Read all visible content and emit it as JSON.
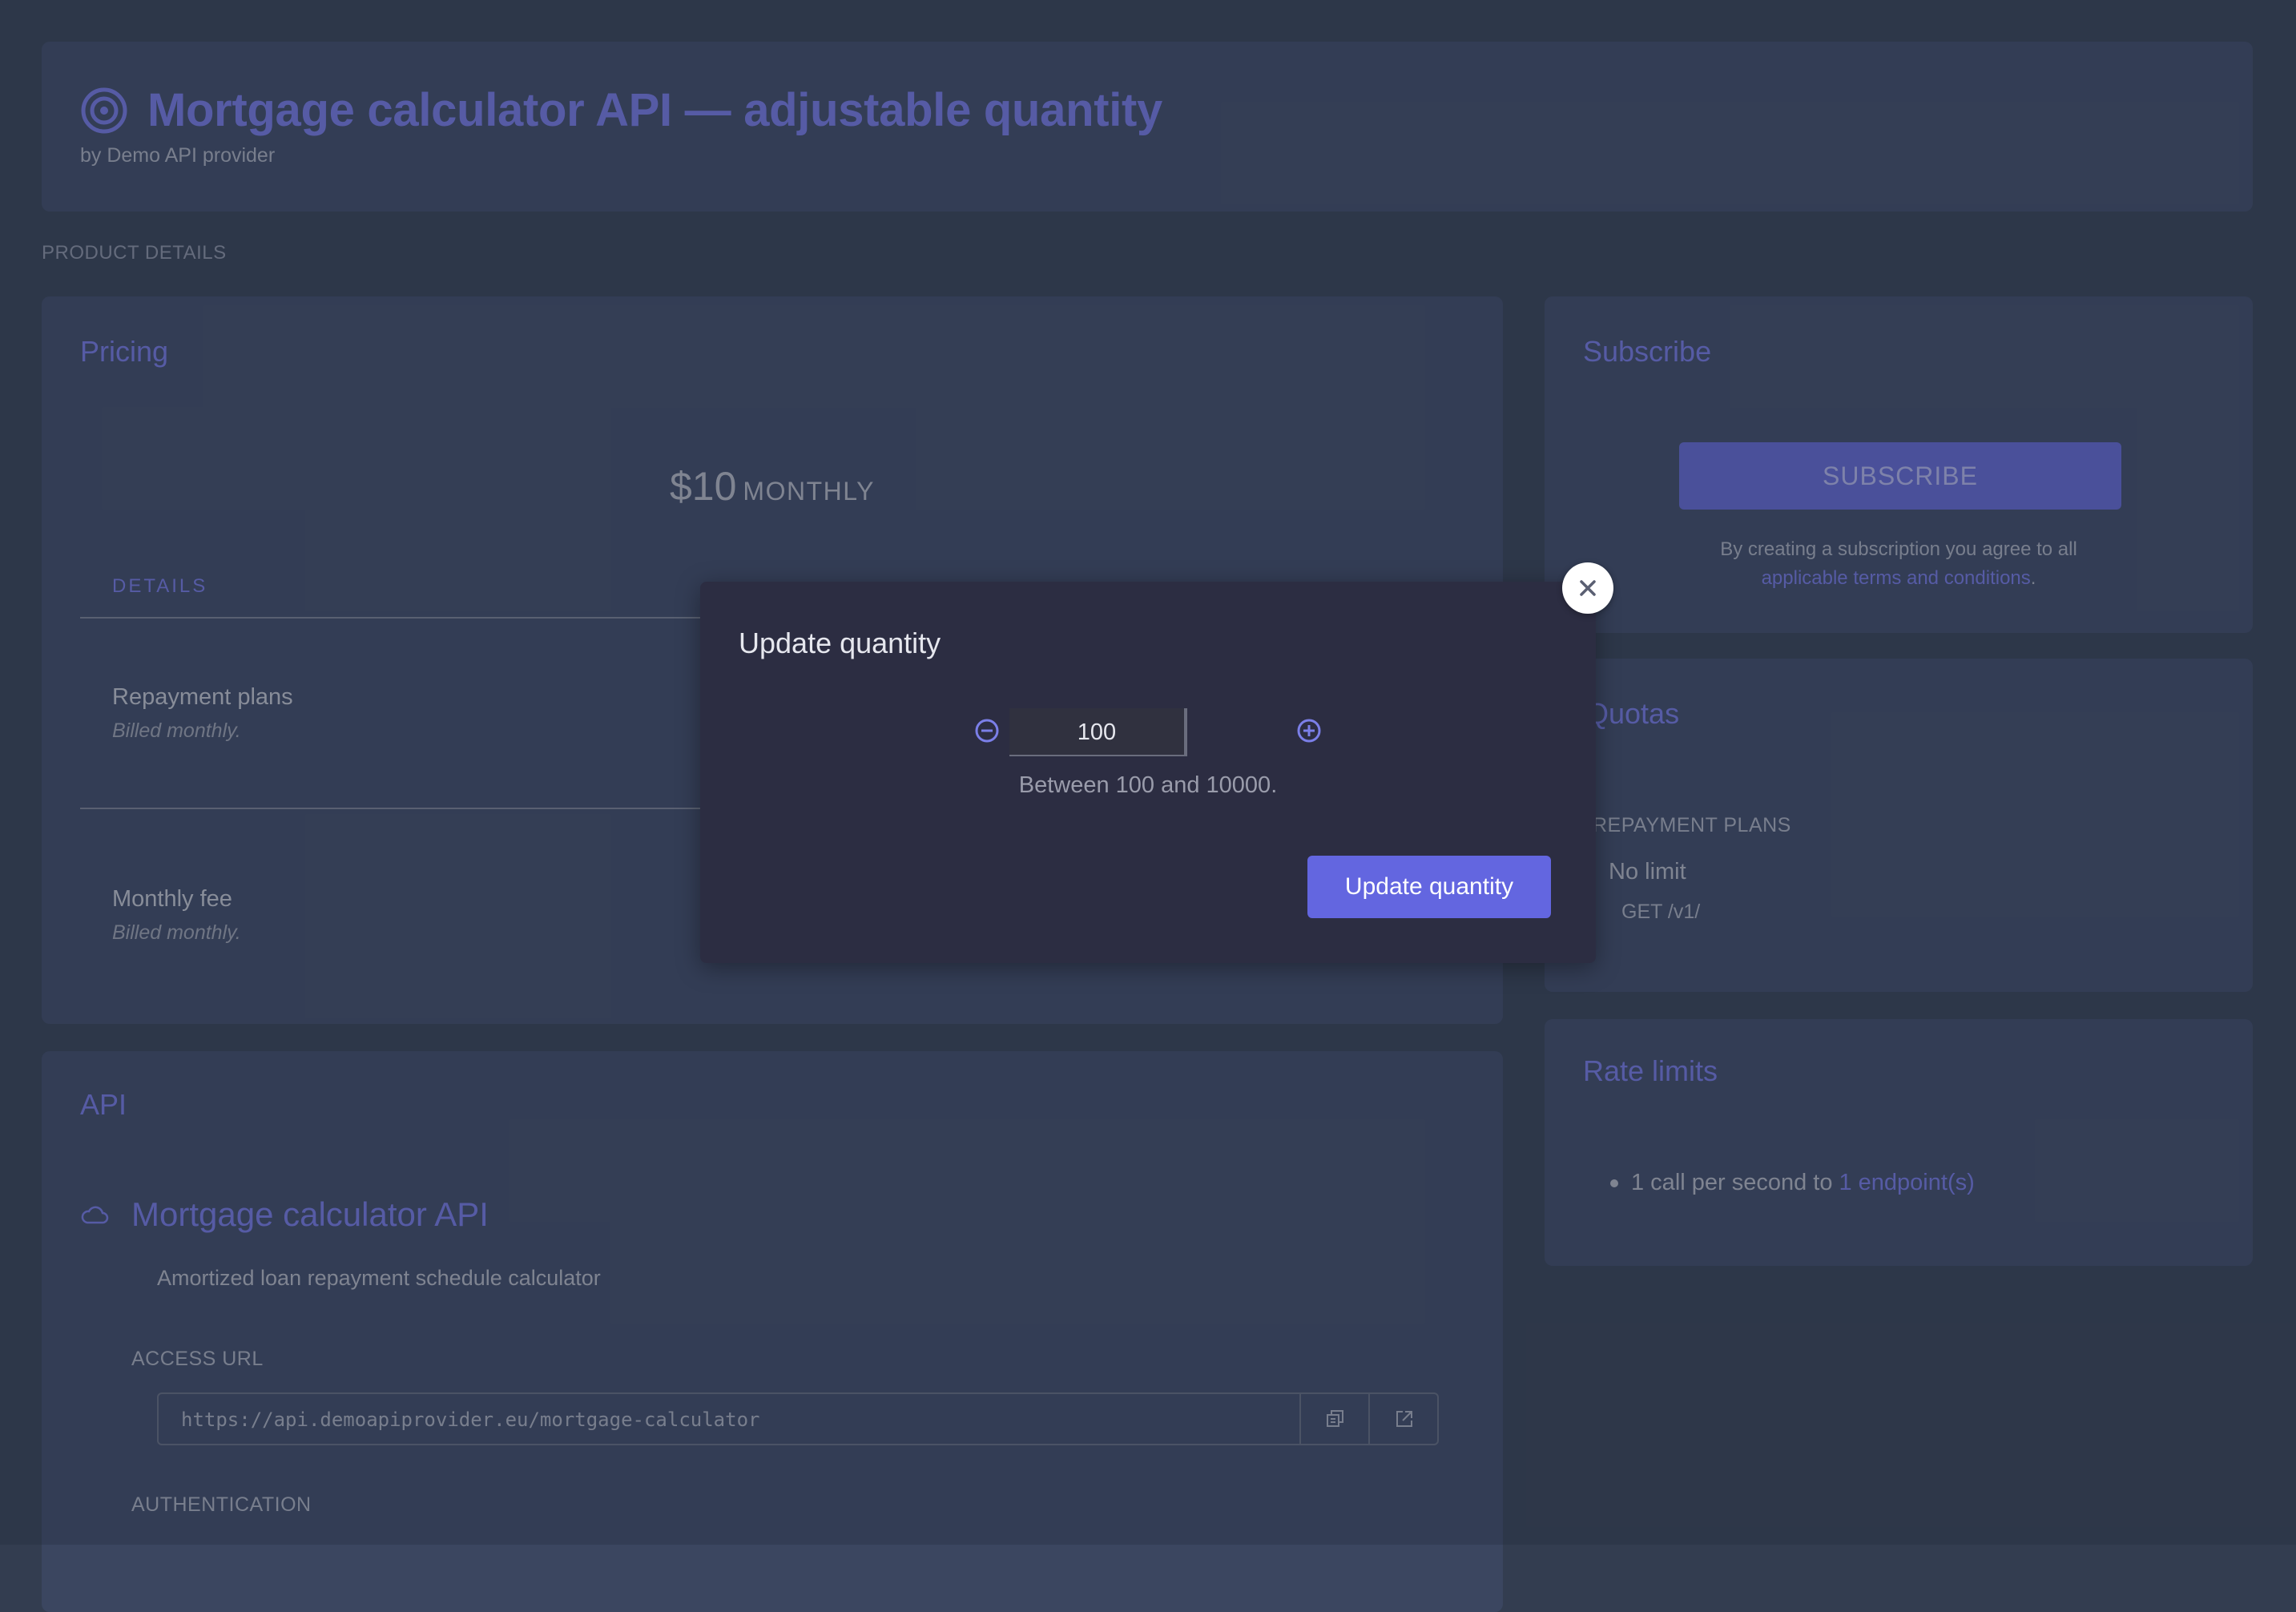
{
  "header": {
    "title": "Mortgage calculator API — adjustable quantity",
    "byline": "by Demo API provider"
  },
  "section_label": "PRODUCT DETAILS",
  "pricing": {
    "title": "Pricing",
    "amount": "$10",
    "period": "MONTHLY",
    "details_label": "DETAILS",
    "items": [
      {
        "name": "Repayment plans",
        "note": "Billed monthly."
      },
      {
        "name": "Monthly fee",
        "note": "Billed monthly."
      }
    ]
  },
  "api": {
    "title": "API",
    "name": "Mortgage calculator API",
    "description": "Amortized loan repayment schedule calculator",
    "access_url_label": "ACCESS URL",
    "access_url": "https://api.demoapiprovider.eu/mortgage-calculator",
    "authentication_label": "AUTHENTICATION"
  },
  "subscribe": {
    "title": "Subscribe",
    "button": "SUBSCRIBE",
    "note": "By creating a subscription you agree to all",
    "terms_link": "applicable terms and conditions",
    "note_end": "."
  },
  "quotas": {
    "title": "Quotas",
    "plan_label": "REPAYMENT PLANS",
    "limit": "No limit",
    "endpoint": "GET /v1/"
  },
  "rate_limits": {
    "title": "Rate limits",
    "item_text": "1 call per second to",
    "item_link": "1 endpoint(s)"
  },
  "modal": {
    "title": "Update quantity",
    "value": "100",
    "hint": "Between 100 and 10000.",
    "button": "Update quantity"
  },
  "colors": {
    "background": "#333d50",
    "card": "#3b4660",
    "accent": "#6b70cf",
    "modal": "#2c2d42",
    "primary_button": "#6366e0"
  },
  "icons": {
    "title_icon": "target-icon",
    "api_icon": "cloud-icon",
    "close": "close-icon",
    "minus": "minus-circle-icon",
    "plus": "plus-circle-icon",
    "copy": "copy-icon",
    "open": "external-link-icon"
  }
}
